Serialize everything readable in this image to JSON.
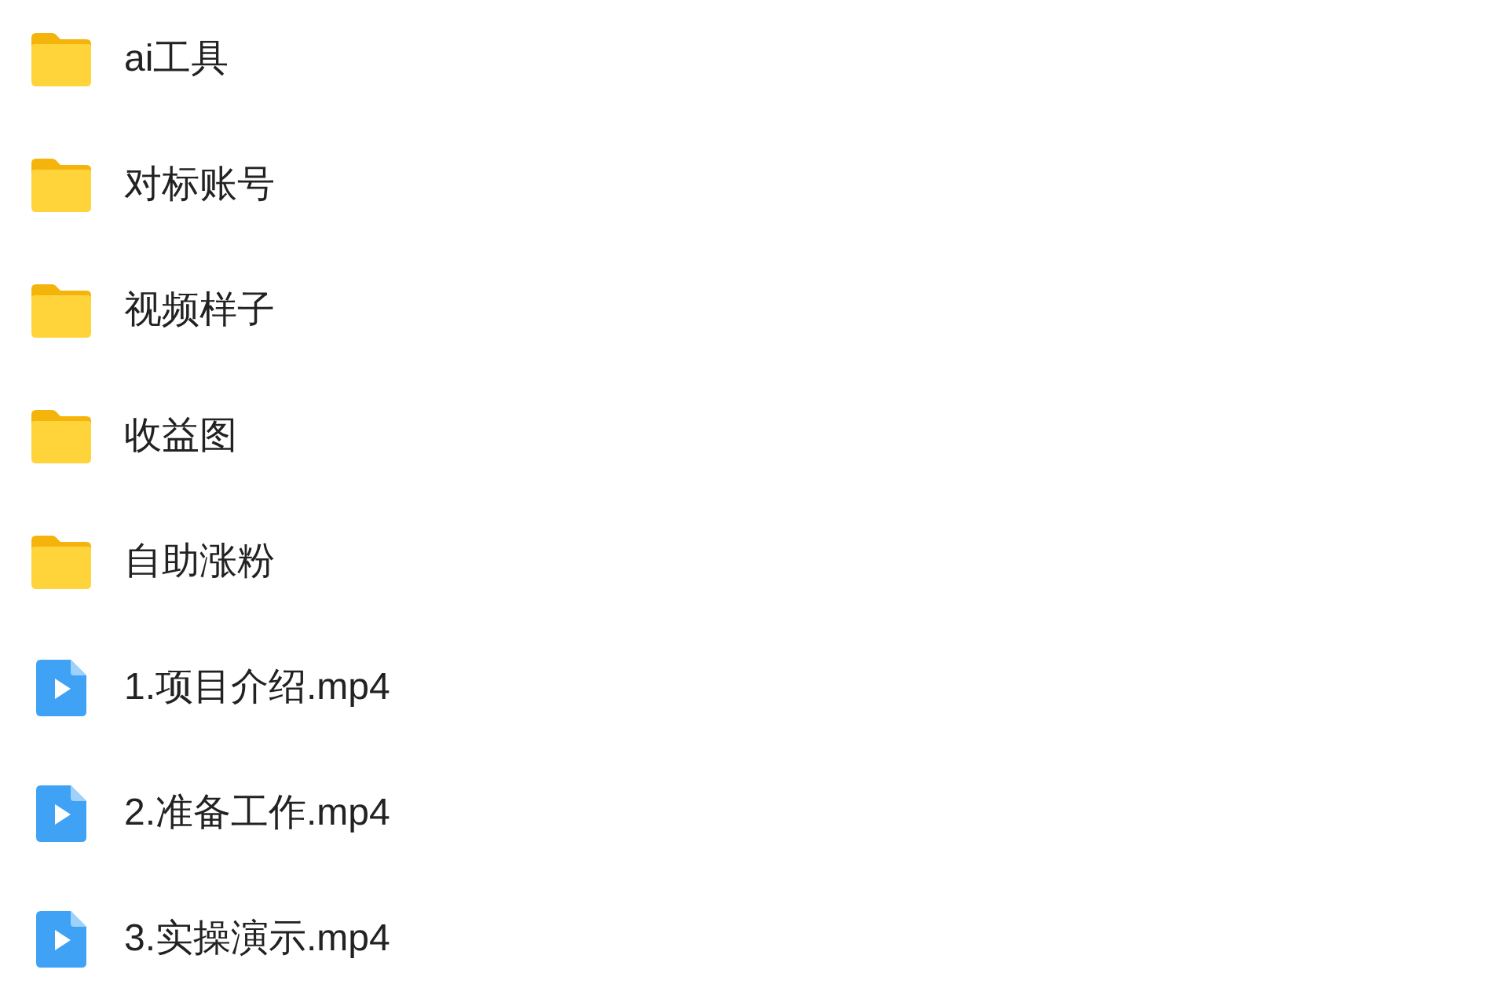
{
  "items": [
    {
      "kind": "folder",
      "name": "ai工具"
    },
    {
      "kind": "folder",
      "name": "对标账号"
    },
    {
      "kind": "folder",
      "name": "视频样子"
    },
    {
      "kind": "folder",
      "name": "收益图"
    },
    {
      "kind": "folder",
      "name": "自助涨粉"
    },
    {
      "kind": "video",
      "name": "1.项目介绍.mp4"
    },
    {
      "kind": "video",
      "name": "2.准备工作.mp4"
    },
    {
      "kind": "video",
      "name": "3.实操演示.mp4"
    }
  ]
}
